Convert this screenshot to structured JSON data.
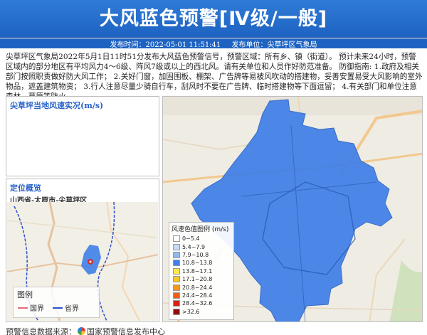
{
  "header": {
    "title": "大风蓝色预警[Ⅳ级/一般]",
    "publish_time": "发布时间：2022-05-01 11:51:41",
    "publish_unit": "发布单位：尖草坪区气象局"
  },
  "description": "尖草坪区气象局2022年5月1日11时51分发布大风蓝色预警信号，预警区域：所有乡、镇（街道）。 预计未来24小时，预警区域内的部分地区有平均风力4～6级、阵风7级或以上的西北风。请有关单位和人员作好防范准备。 防御指南: 1.政府及相关部门按照职责做好防大风工作； 2.关好门窗，加固围板、棚架、广告牌等易被风吹动的搭建物，妥善安置易受大风影响的室外物品，遮盖建筑物资； 3.行人注意尽量少骑自行车，刮风时不要在广告牌、临时搭建物等下面逗留； 4.有关部门和单位注意森林、草原等防火。",
  "wind_panel": {
    "title": "尖草坪当地风速实况(m/s)"
  },
  "location_panel": {
    "title": "定位概览",
    "subtitle": "山西省-太原市-尖草坪区",
    "legend_title": "图例",
    "legend_items": [
      {
        "label": "国界",
        "color": "#e06a7a"
      },
      {
        "label": "省界",
        "color": "#2b50d0"
      }
    ]
  },
  "wind_legend": {
    "title": "风速色值图例 (m/s)",
    "items": [
      {
        "label": "0~5.4",
        "color": "#ffffff"
      },
      {
        "label": "5.4~7.9",
        "color": "#c8daf6"
      },
      {
        "label": "7.9~10.8",
        "color": "#94b8ee"
      },
      {
        "label": "10.8~13.8",
        "color": "#3f7fe8"
      },
      {
        "label": "13.8~17.1",
        "color": "#fde94a"
      },
      {
        "label": "17.1~20.8",
        "color": "#f7c629"
      },
      {
        "label": "20.8~24.4",
        "color": "#f4971f"
      },
      {
        "label": "24.4~28.4",
        "color": "#ee5c1a"
      },
      {
        "label": "28.4~32.6",
        "color": "#d52214"
      },
      {
        "label": ">32.6",
        "color": "#8f0c0c"
      }
    ]
  },
  "footer": {
    "prefix": "预警信息数据来源：",
    "source": "国家预警信息发布中心"
  }
}
